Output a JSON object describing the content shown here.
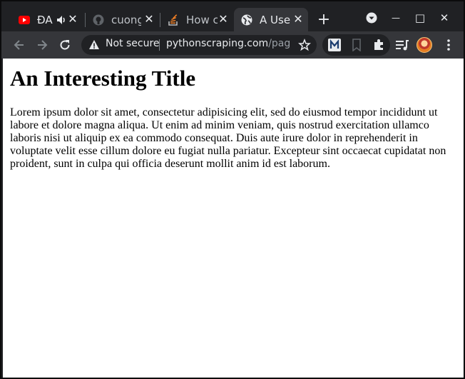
{
  "tabs": [
    {
      "title": "ĐA",
      "icon": "youtube-icon",
      "audio_icon": "speaker-icon",
      "close": "✕"
    },
    {
      "title": "cuong",
      "icon": "github-icon",
      "close": "✕"
    },
    {
      "title": "How c",
      "icon": "stackoverflow-icon",
      "close": "✕"
    },
    {
      "title": "A Use",
      "icon": "globe-icon",
      "close": "✕",
      "active": true
    }
  ],
  "new_tab": "+",
  "window_controls": {
    "minimize": "—",
    "maximize": "□",
    "close": "✕"
  },
  "omnibox": {
    "security_label": "Not secure",
    "domain": "pythonscraping.com",
    "path": "/pag..."
  },
  "page": {
    "heading": "An Interesting Title",
    "paragraph": "Lorem ipsum dolor sit amet, consectetur adipisicing elit, sed do eiusmod tempor incididunt ut labore et dolore magna aliqua. Ut enim ad minim veniam, quis nostrud exercitation ullamco laboris nisi ut aliquip ex ea commodo consequat. Duis aute irure dolor in reprehenderit in voluptate velit esse cillum dolore eu fugiat nulla pariatur. Excepteur sint occaecat cupidatat non proident, sunt in culpa qui officia deserunt mollit anim id est laborum."
  },
  "colors": {
    "tabstrip": "#202124",
    "toolbar": "#35363a",
    "youtube_red": "#ff0000",
    "stackoverflow_orange": "#f48024"
  }
}
